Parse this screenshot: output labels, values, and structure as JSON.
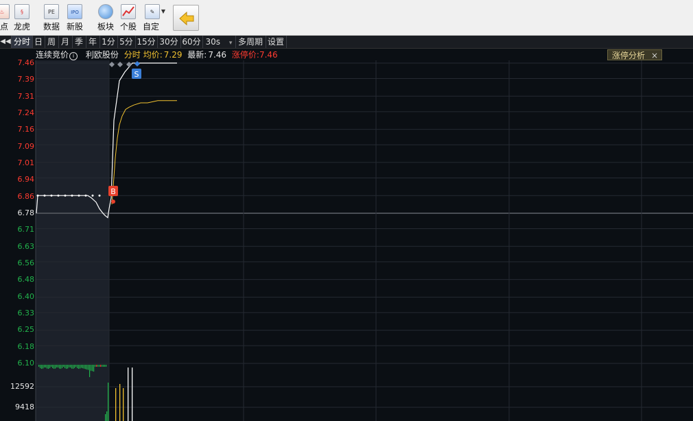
{
  "toolbar": {
    "items": [
      {
        "label": "点",
        "icon": "fire-icon"
      },
      {
        "label": "龙虎",
        "icon": "dragon-icon"
      },
      {
        "label": "数据",
        "icon": "pe-icon",
        "icon_text": "PE"
      },
      {
        "label": "新股",
        "icon": "ipo-icon",
        "icon_text": "IPO"
      },
      {
        "label": "板块",
        "icon": "pie-chart-icon"
      },
      {
        "label": "个股",
        "icon": "line-chart-icon"
      },
      {
        "label": "自定",
        "icon": "edit-icon"
      }
    ],
    "back_icon": "back-arrow-icon"
  },
  "periods": [
    "分时",
    "日",
    "周",
    "月",
    "季",
    "年",
    "1分",
    "5分",
    "15分",
    "30分",
    "60分",
    "30s",
    "多周期",
    "设置"
  ],
  "active_period": "分时",
  "info": {
    "auction": "连续竞价",
    "stock_name": "利欧股份",
    "mode": "分时",
    "avg_label": "均价:",
    "avg_value": "7.29",
    "last_label": "最新:",
    "last_value": "7.46",
    "limit_label": "涨停价:",
    "limit_value": "7.46"
  },
  "limit_analysis": {
    "label": "涨停分析",
    "close": "×"
  },
  "markers": {
    "buy": "B",
    "sell": "S"
  },
  "colors": {
    "up": "#ff3b30",
    "down": "#22b34c",
    "price_line": "#ffffff",
    "avg_line": "#f2c230"
  },
  "chart_data": {
    "type": "line",
    "price_axis": {
      "ticks": [
        7.46,
        7.39,
        7.31,
        7.24,
        7.16,
        7.09,
        7.01,
        6.94,
        6.86,
        6.78,
        6.71,
        6.63,
        6.56,
        6.48,
        6.4,
        6.33,
        6.25,
        6.18,
        6.1
      ],
      "prev_close": 6.78,
      "ylim": [
        6.1,
        7.46
      ]
    },
    "volume_axis": {
      "ticks": [
        12592,
        9418
      ]
    },
    "series": [
      {
        "values": [
          6.78,
          6.86,
          6.86,
          6.86,
          6.86,
          6.86,
          6.85,
          6.83,
          6.8,
          6.78,
          6.77,
          6.76,
          6.8,
          6.85,
          7.2,
          7.38,
          7.42,
          7.46,
          7.46,
          7.46,
          7.46,
          7.46
        ]
      },
      {
        "values": [
          6.82,
          6.9,
          7.03,
          7.12,
          7.18,
          7.22,
          7.25,
          7.26,
          7.27,
          7.28,
          7.28,
          7.29,
          7.29,
          7.29
        ]
      }
    ]
  }
}
